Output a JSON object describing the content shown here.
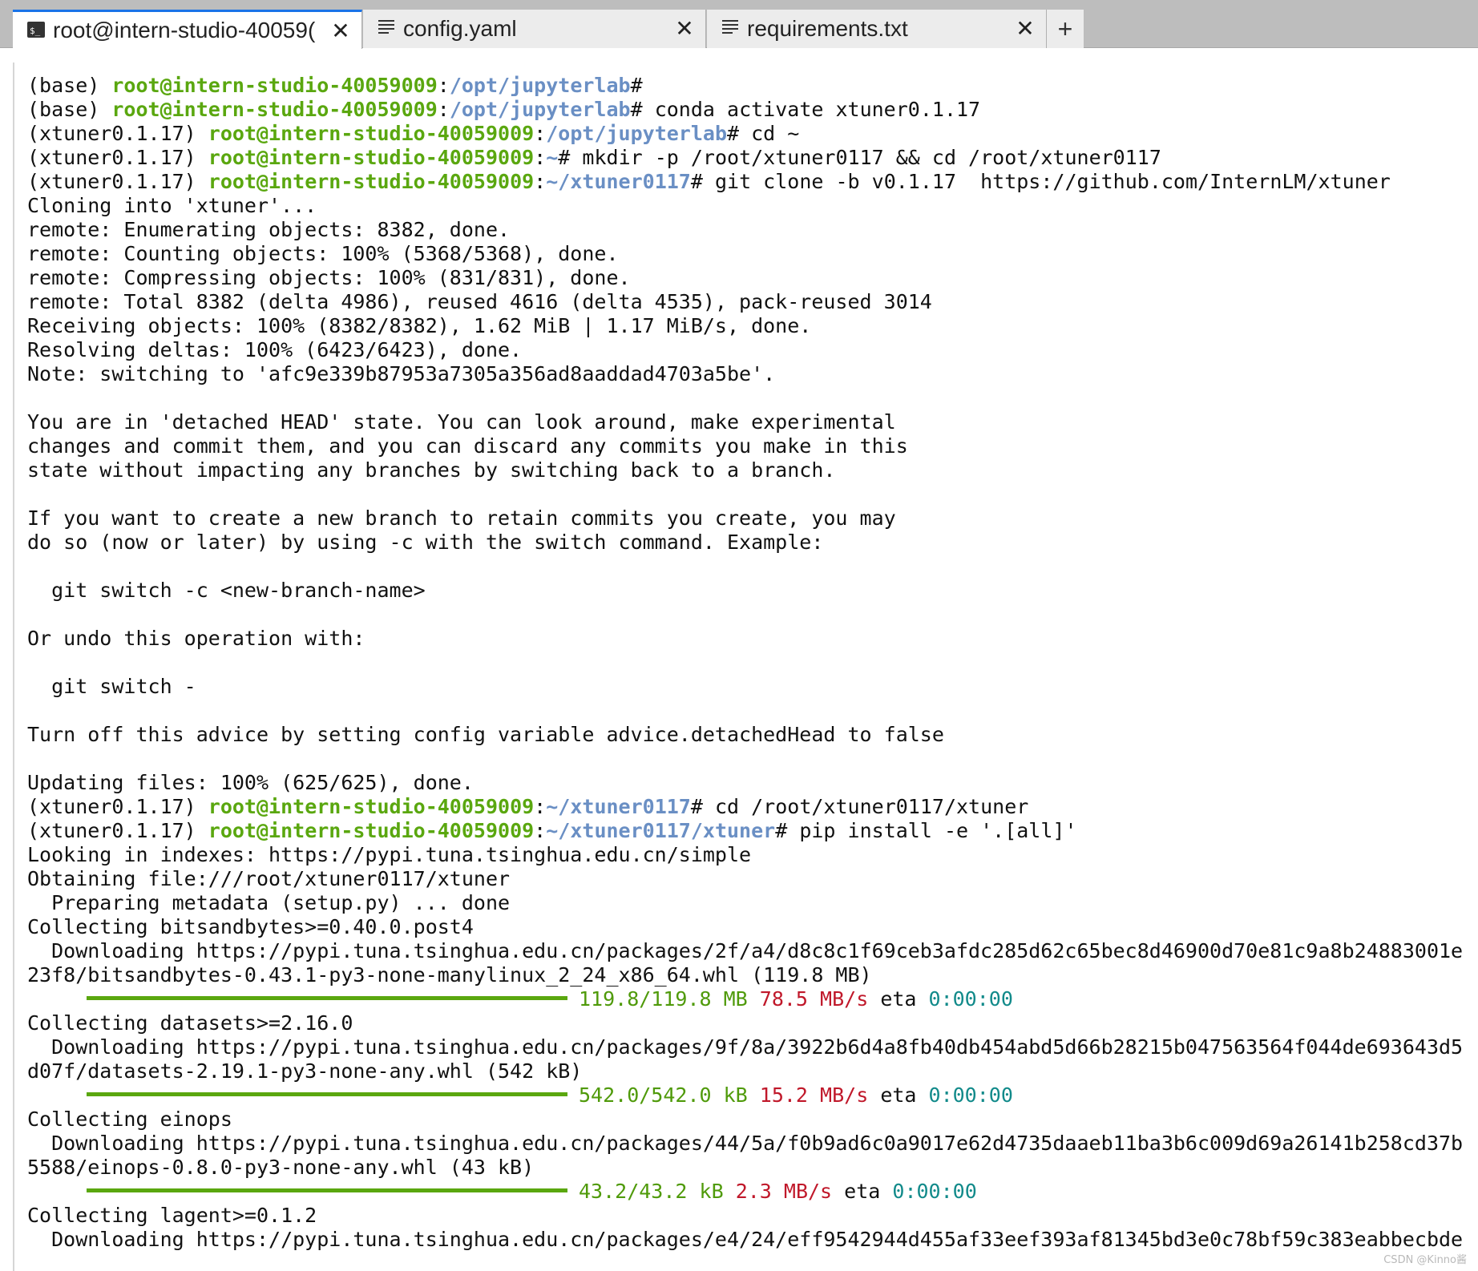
{
  "tabs": [
    {
      "label": "root@intern-studio-40059(",
      "icon": "terminal-icon",
      "active": true
    },
    {
      "label": "config.yaml",
      "icon": "file-text-icon",
      "active": false
    },
    {
      "label": "requirements.txt",
      "icon": "file-text-icon",
      "active": false
    }
  ],
  "add_tab_label": "+",
  "close_glyph": "✕",
  "terminal": {
    "user": "root@intern-studio-40059009",
    "lines": [
      {
        "env": "(base) ",
        "path": "/opt/jupyterlab",
        "cmd": ""
      },
      {
        "env": "(base) ",
        "path": "/opt/jupyterlab",
        "cmd": " conda activate xtuner0.1.17"
      },
      {
        "env": "(xtuner0.1.17) ",
        "path": "/opt/jupyterlab",
        "cmd": " cd ~"
      },
      {
        "env": "(xtuner0.1.17) ",
        "path": "~",
        "cmd": " mkdir -p /root/xtuner0117 && cd /root/xtuner0117"
      },
      {
        "env": "(xtuner0.1.17) ",
        "path": "~/xtuner0117",
        "cmd": " git clone -b v0.1.17  https://github.com/InternLM/xtuner"
      },
      {
        "text": "Cloning into 'xtuner'..."
      },
      {
        "text": "remote: Enumerating objects: 8382, done."
      },
      {
        "text": "remote: Counting objects: 100% (5368/5368), done."
      },
      {
        "text": "remote: Compressing objects: 100% (831/831), done."
      },
      {
        "text": "remote: Total 8382 (delta 4986), reused 4616 (delta 4535), pack-reused 3014"
      },
      {
        "text": "Receiving objects: 100% (8382/8382), 1.62 MiB | 1.17 MiB/s, done."
      },
      {
        "text": "Resolving deltas: 100% (6423/6423), done."
      },
      {
        "text": "Note: switching to 'afc9e339b87953a7305a356ad8aaddad4703a5be'."
      },
      {
        "text": ""
      },
      {
        "text": "You are in 'detached HEAD' state. You can look around, make experimental"
      },
      {
        "text": "changes and commit them, and you can discard any commits you make in this"
      },
      {
        "text": "state without impacting any branches by switching back to a branch."
      },
      {
        "text": ""
      },
      {
        "text": "If you want to create a new branch to retain commits you create, you may"
      },
      {
        "text": "do so (now or later) by using -c with the switch command. Example:"
      },
      {
        "text": ""
      },
      {
        "text": "  git switch -c <new-branch-name>"
      },
      {
        "text": ""
      },
      {
        "text": "Or undo this operation with:"
      },
      {
        "text": ""
      },
      {
        "text": "  git switch -"
      },
      {
        "text": ""
      },
      {
        "text": "Turn off this advice by setting config variable advice.detachedHead to false"
      },
      {
        "text": ""
      },
      {
        "text": "Updating files: 100% (625/625), done."
      },
      {
        "env": "(xtuner0.1.17) ",
        "path": "~/xtuner0117",
        "cmd": " cd /root/xtuner0117/xtuner"
      },
      {
        "env": "(xtuner0.1.17) ",
        "path": "~/xtuner0117/xtuner",
        "cmd": " pip install -e '.[all]'"
      },
      {
        "text": "Looking in indexes: https://pypi.tuna.tsinghua.edu.cn/simple"
      },
      {
        "text": "Obtaining file:///root/xtuner0117/xtuner"
      },
      {
        "text": "  Preparing metadata (setup.py) ... done"
      },
      {
        "text": "Collecting bitsandbytes>=0.40.0.post4"
      },
      {
        "text": "  Downloading https://pypi.tuna.tsinghua.edu.cn/packages/2f/a4/d8c8c1f69ceb3afdc285d62c65bec8d46900d70e81c9a8b24883001e"
      },
      {
        "text": "23f8/bitsandbytes-0.43.1-py3-none-manylinux_2_24_x86_64.whl (119.8 MB)"
      },
      {
        "progress": 1.0,
        "size": "119.8/119.8 MB",
        "speed": "78.5 MB/s",
        "eta_label": "eta",
        "eta": "0:00:00"
      },
      {
        "text": "Collecting datasets>=2.16.0"
      },
      {
        "text": "  Downloading https://pypi.tuna.tsinghua.edu.cn/packages/9f/8a/3922b6d4a8fb40db454abd5d66b28215b047563564f044de693643d5"
      },
      {
        "text": "d07f/datasets-2.19.1-py3-none-any.whl (542 kB)"
      },
      {
        "progress": 1.0,
        "size": "542.0/542.0 kB",
        "speed": "15.2 MB/s",
        "eta_label": "eta",
        "eta": "0:00:00"
      },
      {
        "text": "Collecting einops"
      },
      {
        "text": "  Downloading https://pypi.tuna.tsinghua.edu.cn/packages/44/5a/f0b9ad6c0a9017e62d4735daaeb11ba3b6c009d69a26141b258cd37b"
      },
      {
        "text": "5588/einops-0.8.0-py3-none-any.whl (43 kB)"
      },
      {
        "progress": 1.0,
        "size": "43.2/43.2 kB",
        "speed": "2.3 MB/s",
        "eta_label": "eta",
        "eta": "0:00:00"
      },
      {
        "text": "Collecting lagent>=0.1.2"
      },
      {
        "text": "  Downloading https://pypi.tuna.tsinghua.edu.cn/packages/e4/24/eff9542944d455af33eef393af81345bd3e0c78bf59c383eabbecbde"
      }
    ]
  },
  "watermark": "CSDN @Kinno酱",
  "colors": {
    "user": "#5aa70f",
    "path": "#6a8fc4",
    "progress_bar": "#5aa70f",
    "speed": "#c0182a",
    "eta": "#118a8a",
    "active_tab_accent": "#1a73e8"
  }
}
